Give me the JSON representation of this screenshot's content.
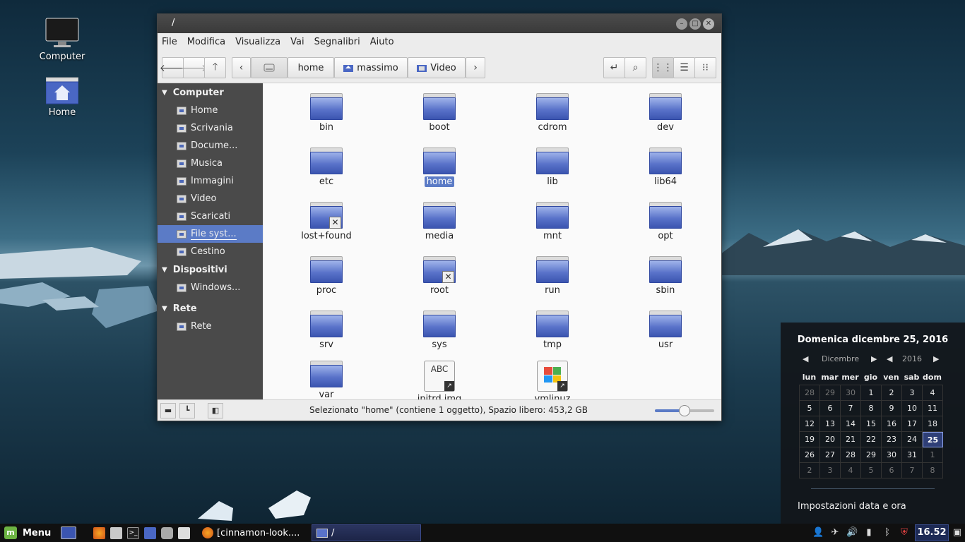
{
  "desktop": {
    "icons": [
      {
        "label": "Computer"
      },
      {
        "label": "Home"
      }
    ]
  },
  "window": {
    "title": "/",
    "menu": [
      "File",
      "Modifica",
      "Visualizza",
      "Vai",
      "Segnalibri",
      "Aiuto"
    ],
    "breadcrumbs": [
      "home",
      "massimo",
      "Video"
    ],
    "sidebar": {
      "sections": [
        {
          "title": "Computer",
          "items": [
            "Home",
            "Scrivania",
            "Docume...",
            "Musica",
            "Immagini",
            "Video",
            "Scaricati",
            "File syst...",
            "Cestino"
          ]
        },
        {
          "title": "Dispositivi",
          "items": [
            "Windows..."
          ]
        },
        {
          "title": "Rete",
          "items": [
            "Rete"
          ]
        }
      ],
      "selected": "File syst..."
    },
    "files": [
      {
        "name": "bin"
      },
      {
        "name": "boot"
      },
      {
        "name": "cdrom"
      },
      {
        "name": "dev"
      },
      {
        "name": "etc"
      },
      {
        "name": "home"
      },
      {
        "name": "lib"
      },
      {
        "name": "lib64"
      },
      {
        "name": "lost+found"
      },
      {
        "name": "media"
      },
      {
        "name": "mnt"
      },
      {
        "name": "opt"
      },
      {
        "name": "proc"
      },
      {
        "name": "root"
      },
      {
        "name": "run"
      },
      {
        "name": "sbin"
      },
      {
        "name": "srv"
      },
      {
        "name": "sys"
      },
      {
        "name": "tmp"
      },
      {
        "name": "usr"
      },
      {
        "name": "var"
      },
      {
        "name": "initrd.img"
      },
      {
        "name": "vmlinuz"
      }
    ],
    "selected_file": "home",
    "doc_thumb_text": "ABC",
    "status": "Selezionato \"home\" (contiene 1 oggetto), Spazio libero: 453,2 GB",
    "zoom_level": 0.5
  },
  "calendar": {
    "title": "Domenica dicembre 25, 2016",
    "month": "Dicembre",
    "year": "2016",
    "weekdays": [
      "lun",
      "mar",
      "mer",
      "gio",
      "ven",
      "sab",
      "dom"
    ],
    "weeks": [
      [
        "28",
        "29",
        "30",
        "1",
        "2",
        "3",
        "4"
      ],
      [
        "5",
        "6",
        "7",
        "8",
        "9",
        "10",
        "11"
      ],
      [
        "12",
        "13",
        "14",
        "15",
        "16",
        "17",
        "18"
      ],
      [
        "19",
        "20",
        "21",
        "22",
        "23",
        "24",
        "25"
      ],
      [
        "26",
        "27",
        "28",
        "29",
        "30",
        "31",
        "1"
      ],
      [
        "2",
        "3",
        "4",
        "5",
        "6",
        "7",
        "8"
      ]
    ],
    "today": "25",
    "settings_label": "Impostazioni data e ora"
  },
  "panel": {
    "menu_label": "Menu",
    "tasks": [
      {
        "label": "[cinnamon-look...."
      },
      {
        "label": "/"
      }
    ],
    "clock": "16.52"
  },
  "colors": {
    "accent": "#5b7bc6",
    "folder": "#5972c9"
  }
}
